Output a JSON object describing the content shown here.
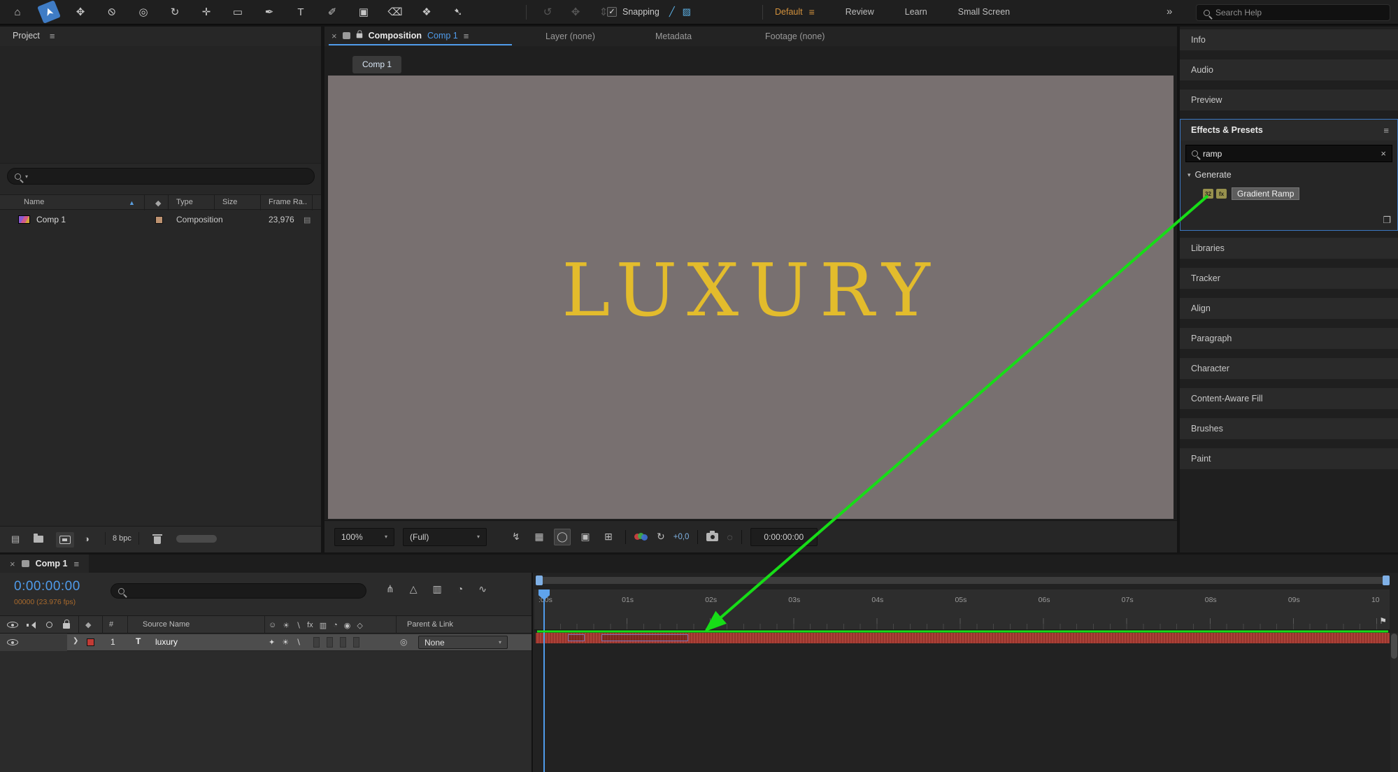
{
  "glyphs": {
    "caret_down": "▾",
    "menu": "≡",
    "close": "×",
    "check": "✓",
    "pickwhip": "◎",
    "sort_asc": "▲",
    "twirl_open": "▾",
    "twirl_closed": "❯",
    "overflow": "»",
    "marker_flag": "⚑"
  },
  "colors": {
    "accent_blue": "#4f9bea",
    "workspace_active_orange": "#d2913c",
    "frame_counter_orange": "#a96a2c",
    "title_gold": "#e3bc2c",
    "layer_bar_red": "#a83a31",
    "annotation_green": "#17dd17",
    "comp_canvas_gray": "#787070",
    "label_chip_red": "#c23b35"
  },
  "toolbar": {
    "tools": [
      {
        "name": "home-icon",
        "glyph": "⌂",
        "cls": "tool"
      },
      {
        "name": "selection-tool-icon",
        "glyph": "➤",
        "cls": "tool active rotsel"
      },
      {
        "name": "hand-tool-icon",
        "glyph": "✥",
        "cls": "tool"
      },
      {
        "name": "zoom-tool-icon",
        "glyph": "⊘",
        "cls": "tool rot90"
      },
      {
        "name": "camera-tool-icon",
        "glyph": "◎",
        "cls": "tool"
      },
      {
        "name": "rotation-tool-icon",
        "glyph": "↻",
        "cls": "tool"
      },
      {
        "name": "pan-behind-tool-icon",
        "glyph": "✛",
        "cls": "tool"
      },
      {
        "name": "rectangle-tool-icon",
        "glyph": "▭",
        "cls": "tool"
      },
      {
        "name": "pen-tool-icon",
        "glyph": "✒",
        "cls": "tool"
      },
      {
        "name": "type-tool-icon",
        "glyph": "T",
        "cls": "tool"
      },
      {
        "name": "brush-tool-icon",
        "glyph": "✐",
        "cls": "tool"
      },
      {
        "name": "clone-stamp-tool-icon",
        "glyph": "▣",
        "cls": "tool"
      },
      {
        "name": "eraser-tool-icon",
        "glyph": "⌫",
        "cls": "tool"
      },
      {
        "name": "roto-brush-tool-icon",
        "glyph": "❖",
        "cls": "tool"
      },
      {
        "name": "puppet-pin-tool-icon",
        "glyph": "➷",
        "cls": "tool"
      }
    ],
    "camera_tools": [
      {
        "name": "orbit-camera-tool-icon",
        "glyph": "↺",
        "cls": "tool dis"
      },
      {
        "name": "pan-camera-tool-icon",
        "glyph": "✥",
        "cls": "tool dis"
      },
      {
        "name": "dolly-camera-tool-icon",
        "glyph": "⇕",
        "cls": "tool dis"
      }
    ],
    "snapping_label": "Snapping",
    "snap_icons": [
      {
        "name": "snap-along-edges-icon",
        "glyph": "╱"
      },
      {
        "name": "snap-inside-comps-icon",
        "glyph": "▨"
      }
    ],
    "workspace_active": "Default",
    "workspaces_rest": [
      {
        "label": "Review",
        "name": "workspace-tab-review"
      },
      {
        "label": "Learn",
        "name": "workspace-tab-learn"
      },
      {
        "label": "Small Screen",
        "name": "workspace-tab-small-screen"
      }
    ],
    "search_placeholder": "Search Help"
  },
  "project": {
    "title": "Project",
    "columns": {
      "name": "Name",
      "type": "Type",
      "size": "Size",
      "frame_rate": "Frame Ra.."
    },
    "row": {
      "name": "Comp 1",
      "type": "Composition",
      "size": "",
      "frame_rate": "23,976"
    },
    "bit_depth": "8 bpc"
  },
  "viewer": {
    "tab_label": "Composition",
    "tab_target": "Comp 1",
    "tabs_inactive": [
      {
        "label": "Layer (none)",
        "name": "viewer-tab-layer"
      },
      {
        "label": "Metadata",
        "name": "viewer-tab-metadata"
      },
      {
        "label": "Footage (none)",
        "name": "viewer-tab-footage"
      }
    ],
    "breadcrumb": "Comp 1",
    "canvas_text": "LUXURY",
    "foot_icons": [
      {
        "name": "fast-previews-icon",
        "glyph": "↯",
        "cls": "vicon"
      },
      {
        "name": "transparency-grid-icon",
        "glyph": "▦",
        "cls": "vicon"
      },
      {
        "name": "mask-visibility-icon",
        "glyph": "◯",
        "cls": "vicon on"
      },
      {
        "name": "region-of-interest-icon",
        "glyph": "▣",
        "cls": "vicon"
      },
      {
        "name": "grid-guides-icon",
        "glyph": "⊞",
        "cls": "vicon"
      }
    ],
    "zoom_value": "100%",
    "resolution_value": "(Full)",
    "exposure_value": "+0,0",
    "preview_time": "0:00:00:00"
  },
  "sidebar": {
    "panels_top": [
      {
        "label": "Info",
        "name": "panel-tab-info"
      },
      {
        "label": "Audio",
        "name": "panel-tab-audio"
      },
      {
        "label": "Preview",
        "name": "panel-tab-preview"
      }
    ],
    "effects": {
      "title": "Effects & Presets",
      "search_value": "ramp",
      "group_label": "Generate",
      "badges": [
        {
          "label": "32",
          "name": "effect-badge-32bpc-icon"
        },
        {
          "label": "fx",
          "name": "effect-badge-gpu-icon"
        }
      ],
      "effect_name": "Gradient Ramp"
    },
    "panels_bottom": [
      {
        "label": "Libraries",
        "name": "panel-tab-libraries"
      },
      {
        "label": "Tracker",
        "name": "panel-tab-tracker"
      },
      {
        "label": "Align",
        "name": "panel-tab-align"
      },
      {
        "label": "Paragraph",
        "name": "panel-tab-paragraph"
      },
      {
        "label": "Character",
        "name": "panel-tab-character"
      },
      {
        "label": "Content-Aware Fill",
        "name": "panel-tab-content-aware-fill"
      },
      {
        "label": "Brushes",
        "name": "panel-tab-brushes"
      },
      {
        "label": "Paint",
        "name": "panel-tab-paint"
      }
    ]
  },
  "timeline": {
    "tab_label": "Comp 1",
    "timecode": "0:00:00:00",
    "frame_info": "00000 (23.976 fps)",
    "top_icons": [
      {
        "name": "composition-mini-flowchart-icon",
        "glyph": "⋔"
      },
      {
        "name": "draft-3d-icon",
        "glyph": "△"
      },
      {
        "name": "frame-blending-icon",
        "glyph": "▥"
      },
      {
        "name": "motion-blur-icon",
        "glyph": "◔"
      },
      {
        "name": "graph-editor-icon",
        "glyph": "∿"
      }
    ],
    "header": {
      "hash": "#",
      "source_name": "Source Name",
      "parent": "Parent & Link"
    },
    "switch_icons": [
      {
        "name": "shy-column-icon",
        "glyph": "☺"
      },
      {
        "name": "collapse-transformations-column-icon",
        "glyph": "☀"
      },
      {
        "name": "quality-column-icon",
        "glyph": "∖"
      },
      {
        "name": "fx-column-icon",
        "glyph": "fx"
      },
      {
        "name": "frame-blend-column-icon",
        "glyph": "▥"
      },
      {
        "name": "motion-blur-column-icon",
        "glyph": "◔"
      },
      {
        "name": "adjustment-layer-column-icon",
        "glyph": "◉"
      },
      {
        "name": "threed-column-icon",
        "glyph": "◇"
      }
    ],
    "layer": {
      "index": "1",
      "type_badge": "T",
      "name": "luxury",
      "parent_value": "None"
    },
    "layer_switch_icons": [
      {
        "name": "layer-shy-icon",
        "glyph": "✦"
      },
      {
        "name": "layer-collapse-icon",
        "glyph": "☀"
      },
      {
        "name": "layer-quality-icon",
        "glyph": "∖"
      }
    ],
    "ruler_labels": [
      ":00s",
      "01s",
      "02s",
      "03s",
      "04s",
      "05s",
      "06s",
      "07s",
      "08s",
      "09s",
      "10"
    ]
  }
}
